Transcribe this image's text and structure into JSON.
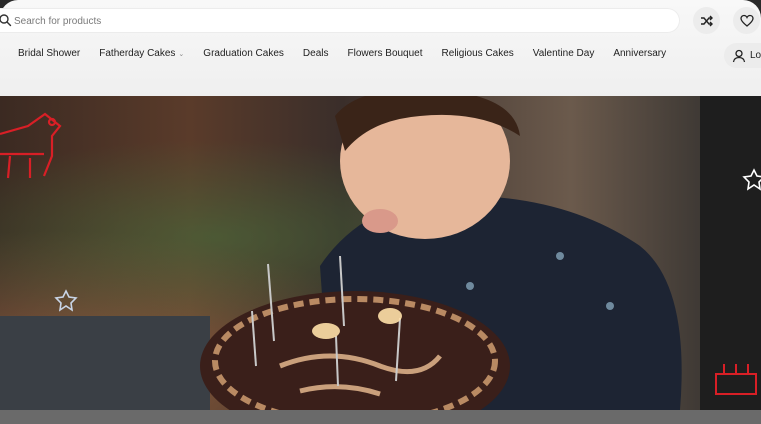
{
  "search": {
    "placeholder": "Search for products"
  },
  "icons": {
    "search": "search-icon",
    "compare": "shuffle-icon",
    "wishlist": "heart-icon",
    "user": "user-icon"
  },
  "nav": {
    "items": [
      {
        "label": "Bridal Shower"
      },
      {
        "label": "Fatherday Cakes",
        "has_dropdown": true
      },
      {
        "label": "Graduation Cakes"
      },
      {
        "label": "Deals"
      },
      {
        "label": "Flowers Bouquet"
      },
      {
        "label": "Religious Cakes"
      },
      {
        "label": "Valentine Day"
      },
      {
        "label": "Anniversary"
      }
    ],
    "login_label": "Lo"
  },
  "colors": {
    "accent_red": "#d81f26",
    "header_bg": "#f4f4f4",
    "text": "#1f1f1f"
  }
}
